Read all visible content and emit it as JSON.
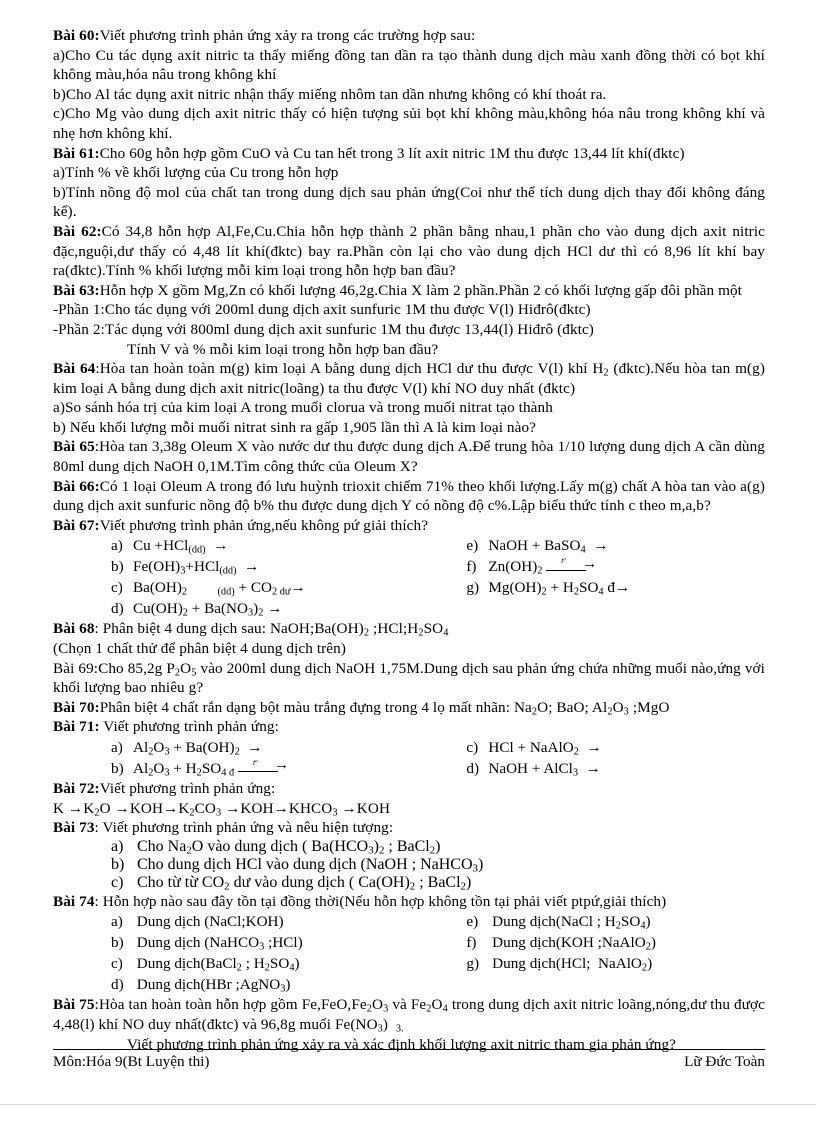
{
  "document": {
    "language": "vi",
    "subject_footer": "Môn:Hóa 9(Bt Luyện thi)",
    "author_footer": "Lữ Đức Toàn"
  },
  "exercises": {
    "b60": {
      "label": "Bài 60:",
      "intro": "Viết phương trình phản ứng xảy ra trong các trường hợp sau:",
      "a": "a)Cho Cu tác dụng axit nitric  ta thấy miếng đồng tan dần ra tạo thành  dung dịch màu xanh  đồng thời có bọt khí không màu,hóa nâu trong không khí",
      "b": "b)Cho Al tác dụng axit nitric  nhận thấy miếng  nhôm tan dần nhưng  không có khí thoát ra.",
      "c": "c)Cho Mg vào dung dịch axit nitric  thấy có hiện tượng sủi bọt khí không màu,không  hóa nâu trong không khí và nhẹ hơn không khí."
    },
    "b61": {
      "label": "Bài 61:",
      "intro": "Cho 60g hỗn hợp gồm CuO và Cu tan hết trong 3 lít axit nitric  1M thu được 13,44 lít khí(đktc)",
      "a": "a)Tính % về khối lượng của Cu trong hỗn hợp",
      "b": "b)Tính nồng độ mol của chất tan trong dung dịch sau phản ứng(Coi như thể tích dung dịch thay đổi không đáng kể)."
    },
    "b62": {
      "label": "Bài 62:",
      "text": "Có 34,8 hỗn hợp Al,Fe,Cu.Chia  hỗn hợp thành  2 phần bằng nhau,1 phần cho vào dung dịch  axit nitric đặc,nguội,dư  thấy có 4,48 lít khí(đktc)  bay ra.Phần còn lại  cho vào dung dịch  HCl dư thì có 8,96 lít khí bay ra(đktc).Tính  % khối lượng mỗi kim loại trong hỗn hợp ban đầu?"
    },
    "b63": {
      "label": "Bài 63:",
      "text": "Hỗn hợp X gồm Mg,Zn có khối lượng 46,2g.Chia  X làm 2 phần.Phần  2 có khối lượng gấp đôi phần một",
      "p1": "-Phần 1:Cho tác dụng với 200ml dung dịch axit sunfuric   1M thu được V(l) Hiđrô(đktc)",
      "p2": "-Phần 2:Tác dụng với 800ml dung dịch axit sunfuric   1M thu được 13,44(l)  Hiđrô  (đktc)",
      "ask": "Tính  V và % mỗi kim loại trong hỗn hợp ban đầu?"
    },
    "b64": {
      "label": "Bài 64",
      "text_pre": ":Hòa tan hoàn toàn m(g) kim loại A bằng dung dịch  HCl dư thu được V(l) khí H",
      "text_sub": "2",
      "text_post": " (đktc).Nếu hòa tan m(g) kim loại A bằng dung dịch axit nitric(loãng)   ta thu được V(l) khí NO duy nhất (đktc)",
      "a": "a)So sánh hóa trị của kim loại A trong muối  clorua và trong muối  nitrat tạo thành",
      "b": "b) Nếu khối lượng mỗi muối nitrat sinh ra gấp 1,905 lần thì A là kim loại nào?"
    },
    "b65": {
      "label": "Bài 65",
      "text": ":Hòa tan 3,38g Oleum X vào nước dư thu được dung dịch A.Để trung hòa 1/10 lượng dung dịch A cần dùng 80ml dung dịch NaOH 0,1M.Tìm  công thức của Oleum X?"
    },
    "b66": {
      "label": "Bài 66:",
      "text": "Có 1 loại  Oleum  A trong đó lưu huỳnh  trioxit chiếm  71% theo khối lượng.Lấy  m(g) chất A hòa tan vào a(g) dung dịch axit sunfuric  nồng độ b% thu được dung dịch Y có nồng độ c%.Lập biểu thức tính  c theo m,a,b?"
    },
    "b67": {
      "label": "Bài 67:",
      "intro": "Viết phương trình phản ứng,nếu không pứ giải thích?",
      "items_left": [
        {
          "tag": "a)",
          "eq": "Cu +HCl(dd)  →"
        },
        {
          "tag": "b)",
          "eq": "Fe(OH)3+HCl(dd)  →"
        },
        {
          "tag": "c)",
          "eq": "Ba(OH)2        (dd) + CO2 dư →"
        },
        {
          "tag": "d)",
          "eq": "Cu(OH)2 + Ba(NO3)2 →"
        }
      ],
      "items_right": [
        {
          "tag": "e)",
          "eq": "NaOH + BaSO4  →"
        },
        {
          "tag": "f)",
          "eq": "Zn(OH)2  --t°-->"
        },
        {
          "tag": "g)",
          "eq": "Mg(OH)2 + H2SO4 đ→"
        }
      ]
    },
    "b68": {
      "label": "Bài 68",
      "text": ": Phân biệt 4 dung dịch sau: NaOH;Ba(OH)2 ;HCl;H2SO4",
      "note": "(Chọn 1 chất thử để phân biệt 4 dung dịch trên)"
    },
    "b69": {
      "label": "Bài 69:",
      "text": "Cho 85,2g  P2O5 vào 200ml dung dịch NaOH 1,75M.Dung  dịch sau phản ứng chứa những muối nào,ứng với khối lượng bao nhiêu g?"
    },
    "b70": {
      "label": "Bài 70:",
      "text": "Phân biệt 4 chất rắn dạng bột màu trắng đựng trong 4 lọ mất nhãn:  Na2O; BaO; Al2O3 ;MgO"
    },
    "b71": {
      "label": "Bài 71:",
      "intro": " Viết phương trình phản ứng:",
      "items_left": [
        {
          "tag": "a)",
          "eq": "Al2O3 + Ba(OH)2  →"
        },
        {
          "tag": "b)",
          "eq": "Al2O3 + H2SO4 đ  --t°-->"
        }
      ],
      "items_right": [
        {
          "tag": "c)",
          "eq": "HCl + NaAlO2  →"
        },
        {
          "tag": "d)",
          "eq": "NaOH + AlCl3  →"
        }
      ]
    },
    "b72": {
      "label": "Bài 72:",
      "intro": "Viết phương trình phản ứng:",
      "chain": "K →K2O →KOH→K2CO3 →KOH→KHCO3 →KOH"
    },
    "b73": {
      "label": "Bài 73",
      "intro": ": Viết phương trình phản ứng và nêu hiện tượng:",
      "items": [
        {
          "tag": "a)",
          "eq": "Cho Na2O vào dung dịch ( Ba(HCO3)2 ; BaCl2)"
        },
        {
          "tag": "b)",
          "eq": "Cho dung dịch HCl vào dung dịch (NaOH ; NaHCO3)"
        },
        {
          "tag": "c)",
          "eq": "Cho từ từ CO2 dư vào dung dịch ( Ca(OH)2 ; BaCl2)"
        }
      ]
    },
    "b74": {
      "label": "Bài 74",
      "intro": ": Hỗn hợp nào sau đây tồn tại đồng thời(Nếu hỗn hợp không tồn tại phải viết ptpứ,giải  thích)",
      "items_left": [
        {
          "tag": "a)",
          "eq": "Dung dịch (NaCl;KOH)"
        },
        {
          "tag": "b)",
          "eq": "Dung dịch (NaHCO3 ;HCl)"
        },
        {
          "tag": "c)",
          "eq": "Dung dịch(BaCl2 ; H2SO4)"
        },
        {
          "tag": "d)",
          "eq": "Dung dịch(HBr ;AgNO3)"
        }
      ],
      "items_right": [
        {
          "tag": "e)",
          "eq": "Dung dịch(NaCl ; H2SO4)"
        },
        {
          "tag": "f)",
          "eq": "Dung dịch(KOH ;NaAlO2)"
        },
        {
          "tag": "g)",
          "eq": "Dung dịch(HCl;  NaAlO2)"
        }
      ]
    },
    "b75": {
      "label": "Bài 75",
      "text": ":Hòa tan hoàn toàn hỗn hợp gồm Fe,FeO,Fe2O3 và Fe2O4 trong dung dịch axit nitric  loãng,nóng,dư  thu được 4,48(l) khí NO duy nhất(đktc)  và 96,8g muối  Fe(NO3)  3.",
      "ask": "Viết phương trình phản ứng xảy ra và xác định khối lượng axit nitric  tham gia phản ứng?"
    }
  }
}
